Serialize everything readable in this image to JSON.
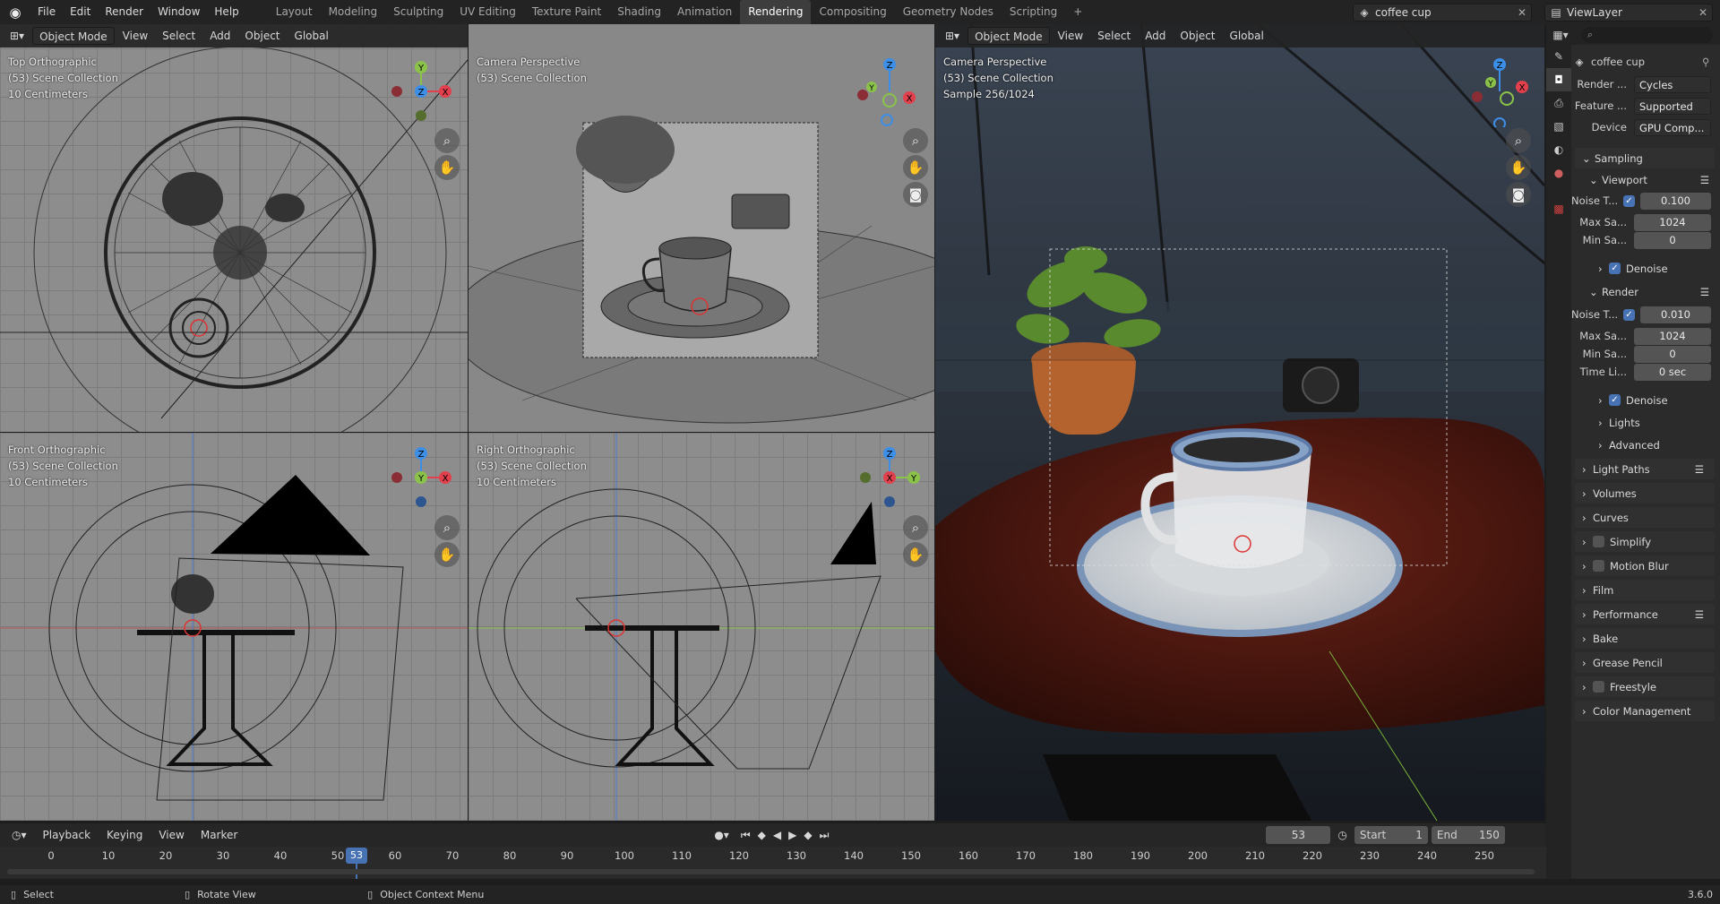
{
  "topbar": {
    "menus": [
      "File",
      "Edit",
      "Render",
      "Window",
      "Help"
    ],
    "workspaces": [
      "Layout",
      "Modeling",
      "Sculpting",
      "UV Editing",
      "Texture Paint",
      "Shading",
      "Animation",
      "Rendering",
      "Compositing",
      "Geometry Nodes",
      "Scripting"
    ],
    "active_workspace": "Rendering",
    "scene_name": "coffee cup",
    "view_layer": "ViewLayer"
  },
  "viewport_header": {
    "mode": "Object Mode",
    "view": "View",
    "select": "Select",
    "add": "Add",
    "object": "Object",
    "orientation": "Global"
  },
  "viewports": {
    "top": {
      "line1": "Top Orthographic",
      "line2": "(53) Scene Collection",
      "line3": "10 Centimeters"
    },
    "camera_wire": {
      "line1": "Camera Perspective",
      "line2": "(53) Scene Collection"
    },
    "front": {
      "line1": "Front Orthographic",
      "line2": "(53) Scene Collection",
      "line3": "10 Centimeters"
    },
    "right": {
      "line1": "Right Orthographic",
      "line2": "(53) Scene Collection",
      "line3": "10 Centimeters"
    },
    "render": {
      "line1": "Camera Perspective",
      "line2": "(53) Scene Collection",
      "line3": "Sample 256/1024"
    }
  },
  "gizmo_labels": {
    "x": "X",
    "y": "Y",
    "z": "Z"
  },
  "properties": {
    "search_placeholder": "",
    "object_name": "coffee cup",
    "render_engine_label": "Render ...",
    "render_engine": "Cycles",
    "feature_label": "Feature ...",
    "feature_set": "Supported",
    "device_label": "Device",
    "device": "GPU Comp...",
    "sampling": "Sampling",
    "viewport": "Viewport",
    "noise_label": "Noise T...",
    "viewport_noise": "0.100",
    "max_label": "Max Sa...",
    "viewport_max": "1024",
    "min_label": "Min Sa...",
    "viewport_min": "0",
    "denoise": "Denoise",
    "render": "Render",
    "render_noise": "0.010",
    "render_max": "1024",
    "render_min": "0",
    "time_label": "Time Li...",
    "time_limit": "0 sec",
    "lights": "Lights",
    "advanced": "Advanced",
    "panels": [
      "Light Paths",
      "Volumes",
      "Curves",
      "Simplify",
      "Motion Blur",
      "Film",
      "Performance",
      "Bake",
      "Grease Pencil",
      "Freestyle",
      "Color Management"
    ]
  },
  "timeline": {
    "playback": "Playback",
    "keying": "Keying",
    "view": "View",
    "marker": "Marker",
    "current_frame": "53",
    "start_label": "Start",
    "start": "1",
    "end_label": "End",
    "end": "150",
    "ticks": [
      "0",
      "10",
      "20",
      "30",
      "40",
      "50",
      "60",
      "70",
      "80",
      "90",
      "100",
      "110",
      "120",
      "130",
      "140",
      "150",
      "160",
      "170",
      "180",
      "190",
      "200",
      "210",
      "220",
      "230",
      "240",
      "250"
    ]
  },
  "status": {
    "select": "Select",
    "rotate": "Rotate View",
    "context": "Object Context Menu",
    "version": "3.6.0"
  },
  "colors": {
    "accent": "#4772b3",
    "x_axis": "#e2404d",
    "y_axis": "#8bc34a",
    "z_axis": "#3d8ee6"
  }
}
